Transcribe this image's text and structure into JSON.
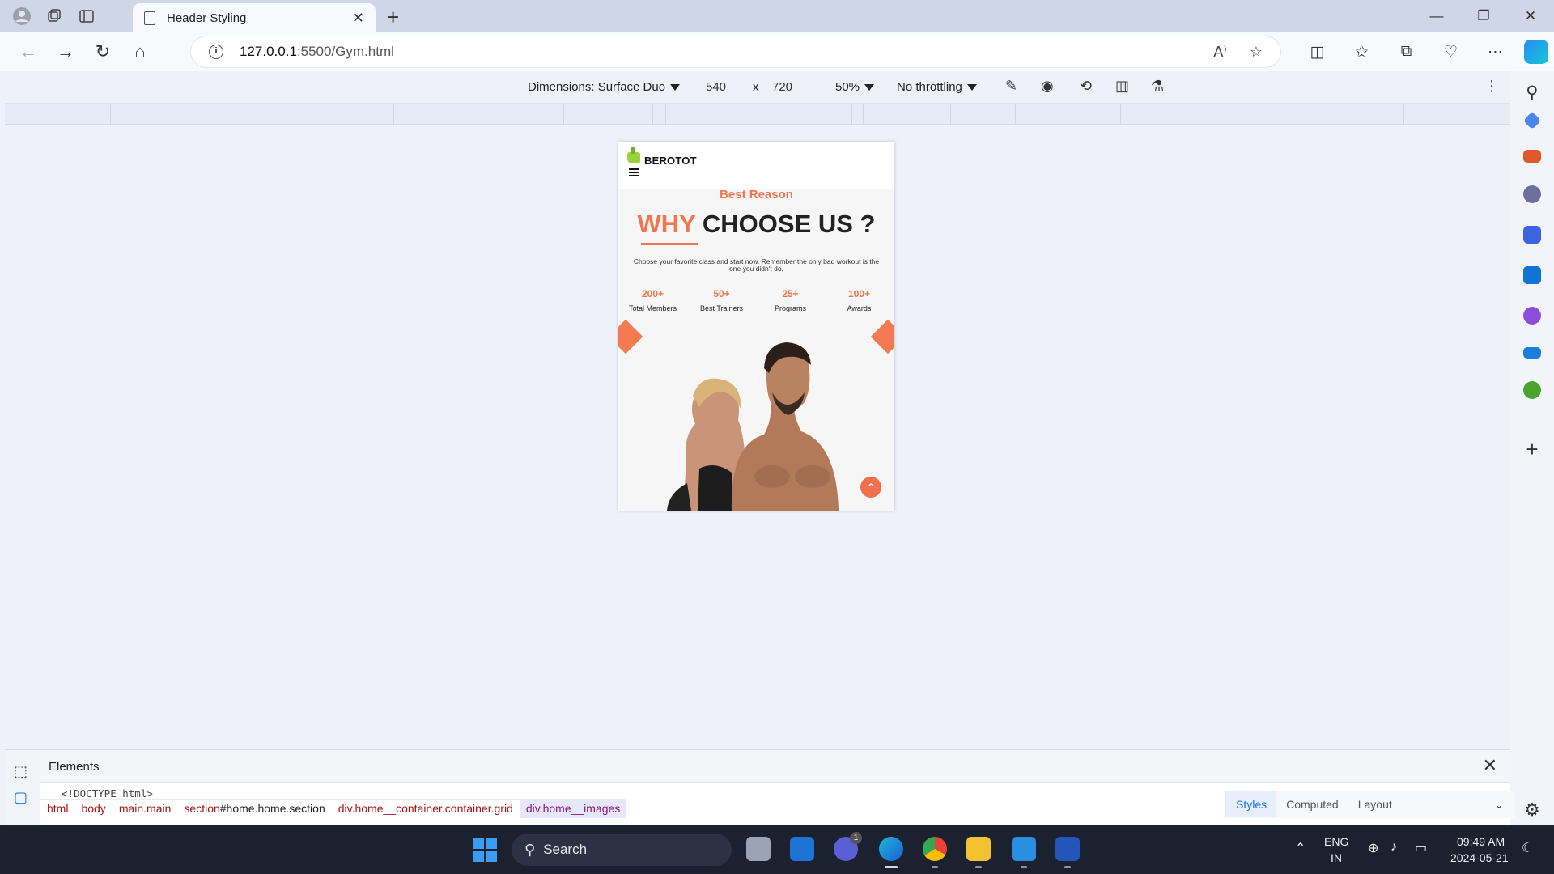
{
  "browser": {
    "tab_title": "Header Styling",
    "url_host": "127.0.0.1",
    "url_path": ":5500/Gym.html"
  },
  "devtools_toolbar": {
    "dimensions": "Dimensions: Surface Duo",
    "width": "540",
    "times": "x",
    "height": "720",
    "zoom": "50%",
    "throttling": "No throttling"
  },
  "page": {
    "logo": "BEROTOT",
    "subtitle": "Best Reason",
    "headline_accent": "WHY",
    "headline_rest": "CHOOSE US ?",
    "description": "Choose your favorite class and start now. Remember the only bad workout is the one you didn't do.",
    "stats": [
      {
        "num": "200+",
        "label": "Total Members"
      },
      {
        "num": "50+",
        "label": "Best Trainers"
      },
      {
        "num": "25+",
        "label": "Programs"
      },
      {
        "num": "100+",
        "label": "Awards"
      }
    ],
    "accent_color": "#f07550"
  },
  "devtools": {
    "panel_title": "Elements",
    "doctype": "<!DOCTYPE html>",
    "crumbs": [
      {
        "tag": "html",
        "rest": ""
      },
      {
        "tag": "body",
        "rest": ""
      },
      {
        "tag": "main.main",
        "rest": ""
      },
      {
        "tag": "section",
        "rest": "#home.home.section"
      },
      {
        "tag": "div.home__container.container.grid",
        "rest": ""
      },
      {
        "tag": "div.home__images",
        "rest": ""
      }
    ],
    "side_tabs": {
      "styles": "Styles",
      "computed": "Computed",
      "layout": "Layout"
    }
  },
  "taskbar": {
    "search": "Search",
    "lang_top": "ENG",
    "lang_bottom": "IN",
    "time": "09:49 AM",
    "date": "2024-05-21",
    "teams_badge": "1"
  }
}
